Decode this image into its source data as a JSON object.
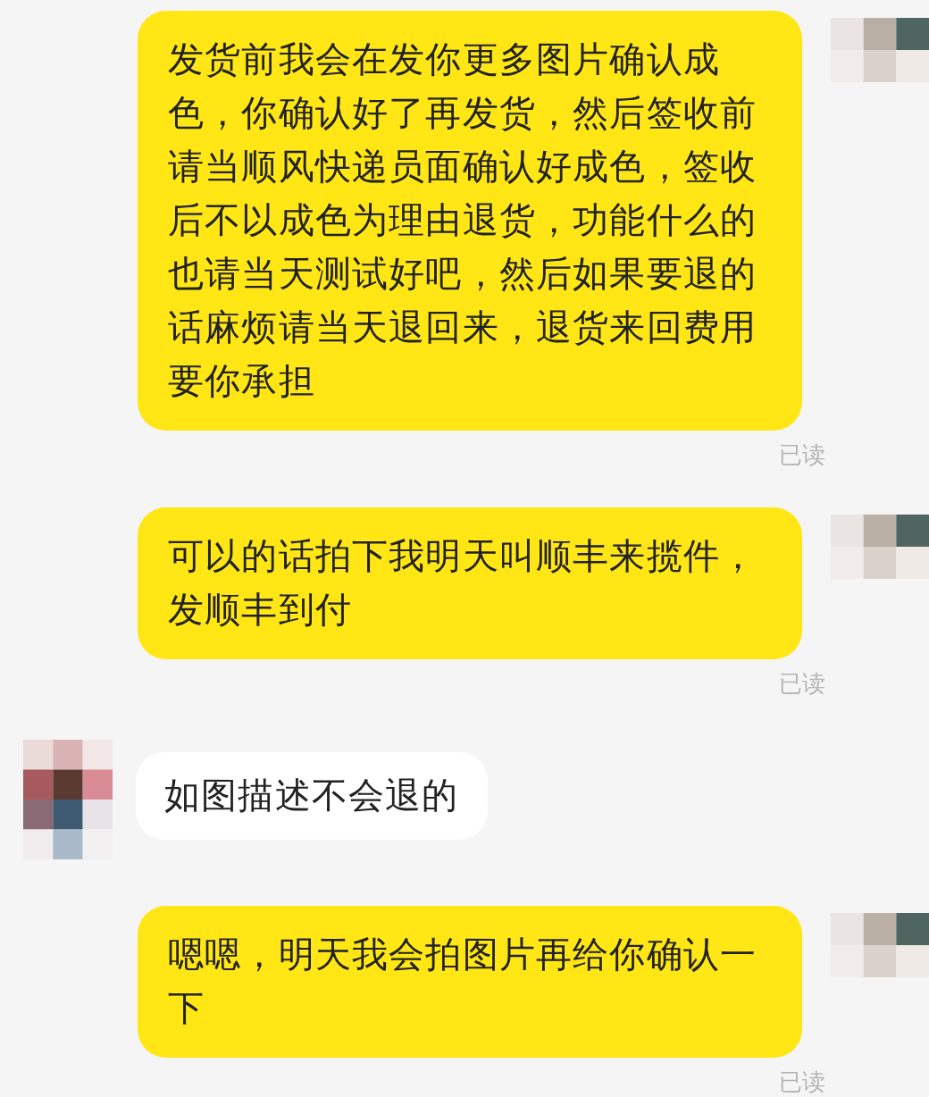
{
  "messages": [
    {
      "kind": "out",
      "text": "发货前我会在发你更多图片确认成色，你确认好了再发货，然后签收前请当顺风快递员面确认好成色，签收后不以成色为理由退货，功能什么的也请当天测试好吧，然后如果要退的话麻烦请当天退回来，退货来回费用要你承担",
      "status": "已读"
    },
    {
      "kind": "out",
      "text": "可以的话拍下我明天叫顺丰来揽件，发顺丰到付",
      "status": "已读"
    },
    {
      "kind": "in",
      "text": "如图描述不会退的"
    },
    {
      "kind": "out",
      "text": "嗯嗯，明天我会拍图片再给你确认一下",
      "status": "已读"
    }
  ]
}
